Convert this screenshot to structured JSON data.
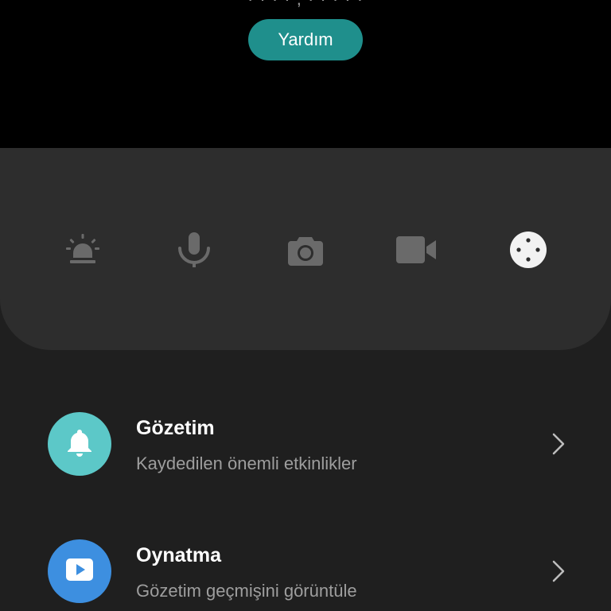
{
  "video": {
    "partial_text": "· · · · , · · · · ·",
    "help_label": "Yardım"
  },
  "controls": [
    {
      "name": "alarm-siren",
      "icon": "siren-icon"
    },
    {
      "name": "microphone",
      "icon": "microphone-icon"
    },
    {
      "name": "screenshot",
      "icon": "camera-icon"
    },
    {
      "name": "record",
      "icon": "video-camera-icon"
    },
    {
      "name": "direction-pad",
      "icon": "joystick-icon"
    }
  ],
  "list": {
    "items": [
      {
        "title": "Gözetim",
        "subtitle": "Kaydedilen önemli etkinlikler",
        "icon": "bell-icon",
        "icon_color": "#5cc8c8"
      },
      {
        "title": "Oynatma",
        "subtitle": "Gözetim geçmişini görüntüle",
        "icon": "play-icon",
        "icon_color": "#3d8fe0"
      }
    ]
  },
  "colors": {
    "accent": "#1f8f8c",
    "panel": "#2d2d2d",
    "background": "#1f1f1f",
    "inactive_icon": "#6a6a6a",
    "active_icon": "#f2f2f2"
  }
}
